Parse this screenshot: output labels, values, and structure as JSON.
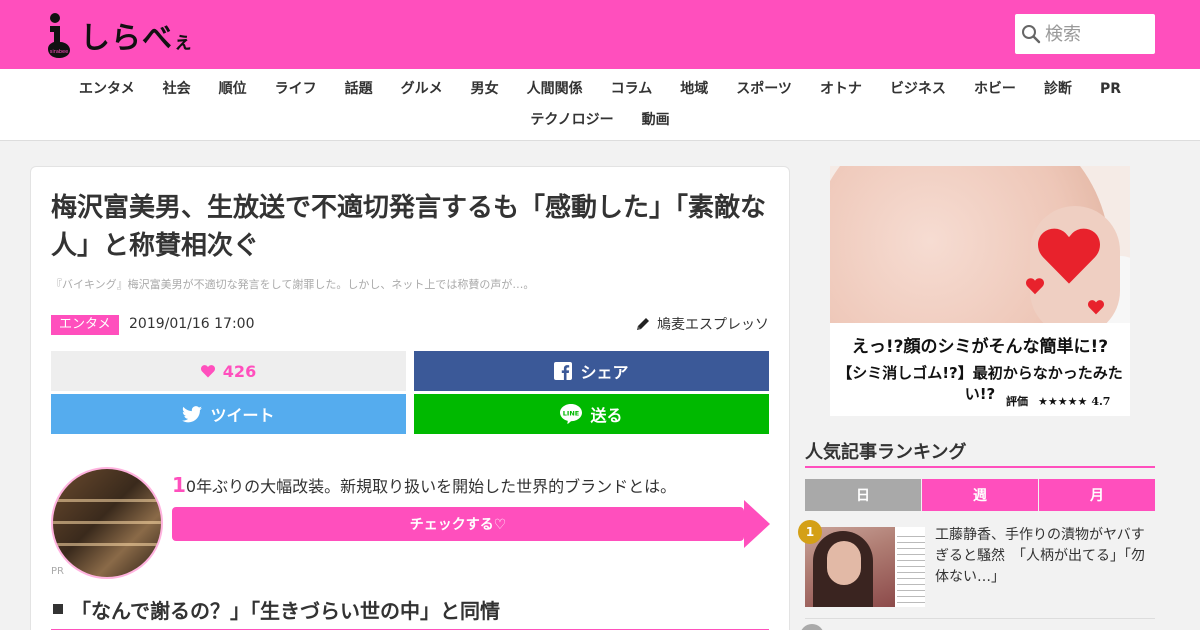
{
  "site": {
    "name_main": "しらべ",
    "name_small": "ぇ"
  },
  "search": {
    "placeholder": "検索"
  },
  "nav": {
    "row1": [
      "エンタメ",
      "社会",
      "順位",
      "ライフ",
      "話題",
      "グルメ",
      "男女",
      "人間関係",
      "コラム",
      "地域",
      "スポーツ",
      "オトナ",
      "ビジネス",
      "ホビー",
      "診断",
      "PR"
    ],
    "row2": [
      "テクノロジー",
      "動画"
    ]
  },
  "article": {
    "title": "梅沢富美男、生放送で不適切発言するも「感動した」「素敵な人」と称賛相次ぐ",
    "lede": "『バイキング』梅沢富美男が不適切な発言をして謝罪した。しかし、ネット上では称賛の声が…。",
    "category": "エンタメ",
    "date": "2019/01/16 17:00",
    "author": "鳩麦エスプレッソ",
    "like_count": "426",
    "share_label": "シェア",
    "tweet_label": "ツイート",
    "line_label": "送る",
    "section_heading": "「なんで謝るの？」「生きづらい世の中」と同情"
  },
  "pr": {
    "label": "PR",
    "text_first": "1",
    "text_rest": "0年ぶりの大幅改装。新規取り扱いを開始した世界的ブランドとは。",
    "cta": "チェックする♡"
  },
  "ad": {
    "line1": "えっ!?顔のシミがそんな簡単に!?",
    "line2": "【シミ消しゴム!?】最初からなかったみたい!?",
    "rating_label": "評価",
    "stars": "★★★★★",
    "score": "4.7"
  },
  "ranking": {
    "title": "人気記事ランキング",
    "tabs": [
      "日",
      "週",
      "月"
    ],
    "items": [
      {
        "rank": "1",
        "title": "工藤静香、手作りの漬物がヤバすぎると騒然　「人柄が出てる」「勿体ない…」"
      }
    ]
  },
  "colors": {
    "brand": "#ff4fbd",
    "facebook": "#3b5998",
    "twitter": "#55acee",
    "line": "#00b900",
    "rank_gold": "#d4a017"
  }
}
